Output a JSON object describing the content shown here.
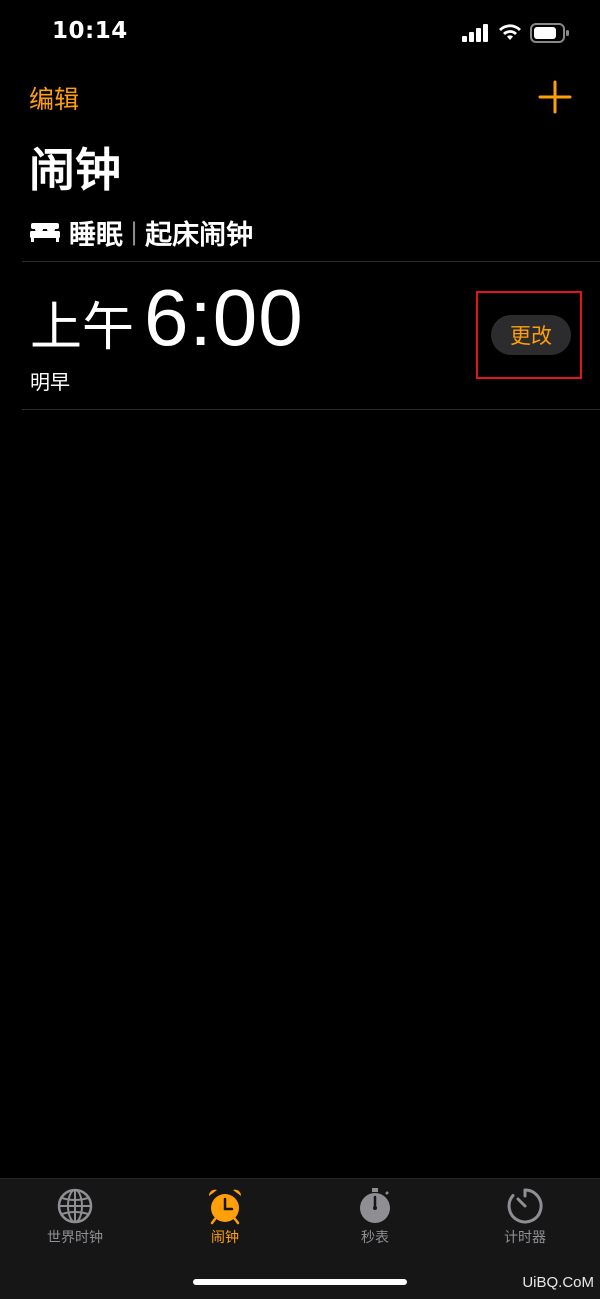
{
  "status_bar": {
    "time": "10:14"
  },
  "header": {
    "edit_label": "编辑",
    "title": "闹钟"
  },
  "sleep": {
    "label": "睡眠",
    "separator": "|",
    "subtitle": "起床闹钟"
  },
  "alarm": {
    "ampm": "上午",
    "time": "6:00",
    "day": "明早",
    "change_label": "更改"
  },
  "tabs": [
    {
      "label": "世界时钟",
      "icon": "globe-icon",
      "active": false
    },
    {
      "label": "闹钟",
      "icon": "alarm-clock-icon",
      "active": true
    },
    {
      "label": "秒表",
      "icon": "stopwatch-icon",
      "active": false
    },
    {
      "label": "计时器",
      "icon": "timer-icon",
      "active": false
    }
  ],
  "watermark": "UiBQ.CoM",
  "colors": {
    "accent": "#ff9f0a",
    "background": "#000000",
    "highlight_box": "#e0161c"
  }
}
